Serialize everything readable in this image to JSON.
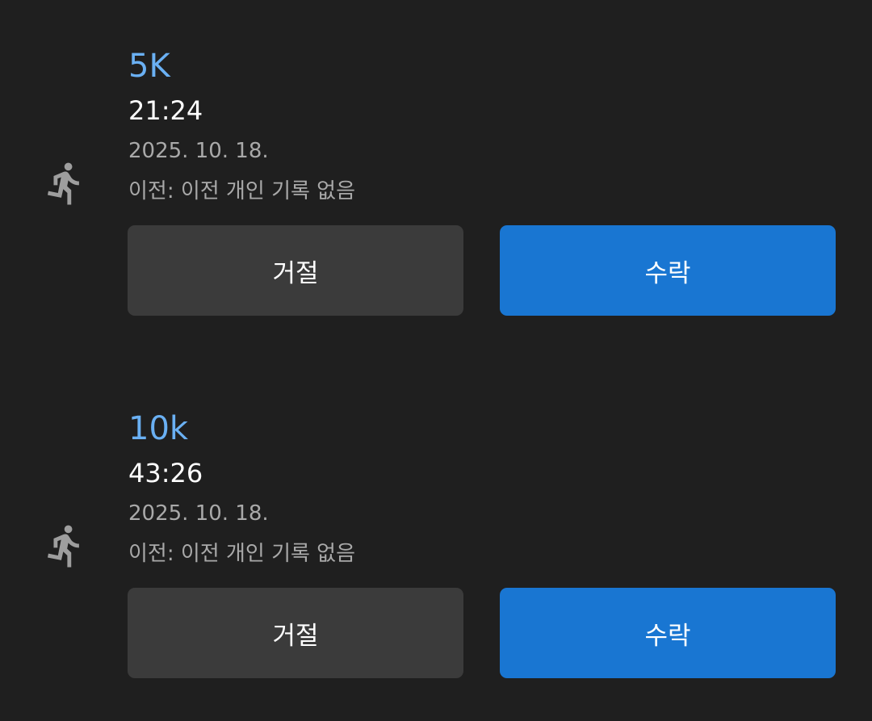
{
  "records": [
    {
      "icon": "running-person-icon",
      "distance": "5K",
      "time": "21:24",
      "date": "2025. 10. 18.",
      "previous": "이전: 이전 개인 기록 없음",
      "reject_label": "거절",
      "accept_label": "수락"
    },
    {
      "icon": "running-person-icon",
      "distance": "10k",
      "time": "43:26",
      "date": "2025. 10. 18.",
      "previous": "이전: 이전 개인 기록 없음",
      "reject_label": "거절",
      "accept_label": "수락"
    }
  ],
  "colors": {
    "background": "#1f1f1f",
    "distance": "#6ab0f3",
    "secondary_text": "#a9a9a9",
    "reject_button": "#3b3b3b",
    "accept_button": "#1976d2"
  }
}
